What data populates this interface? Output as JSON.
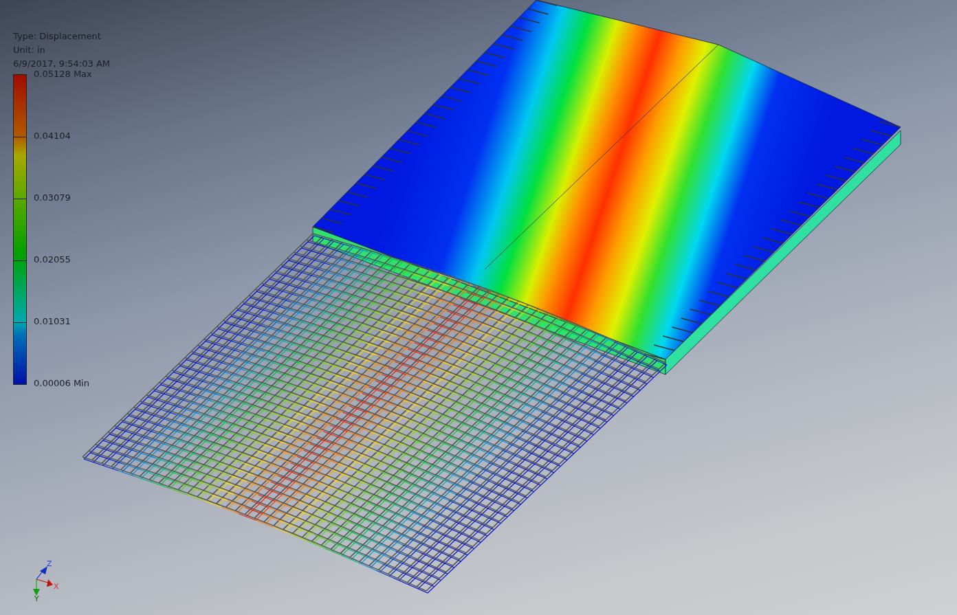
{
  "legend": {
    "type_label": "Type: Displacement",
    "unit_label": "Unit: in",
    "timestamp": "6/9/2017, 9:54:03 AM",
    "ticks": [
      "0.05128 Max",
      "0.04104",
      "0.03079",
      "0.02055",
      "0.01031",
      "0.00006 Min"
    ]
  },
  "axis_triad": {
    "z_label": "Z",
    "x_label": "X",
    "y_label": "Y"
  }
}
